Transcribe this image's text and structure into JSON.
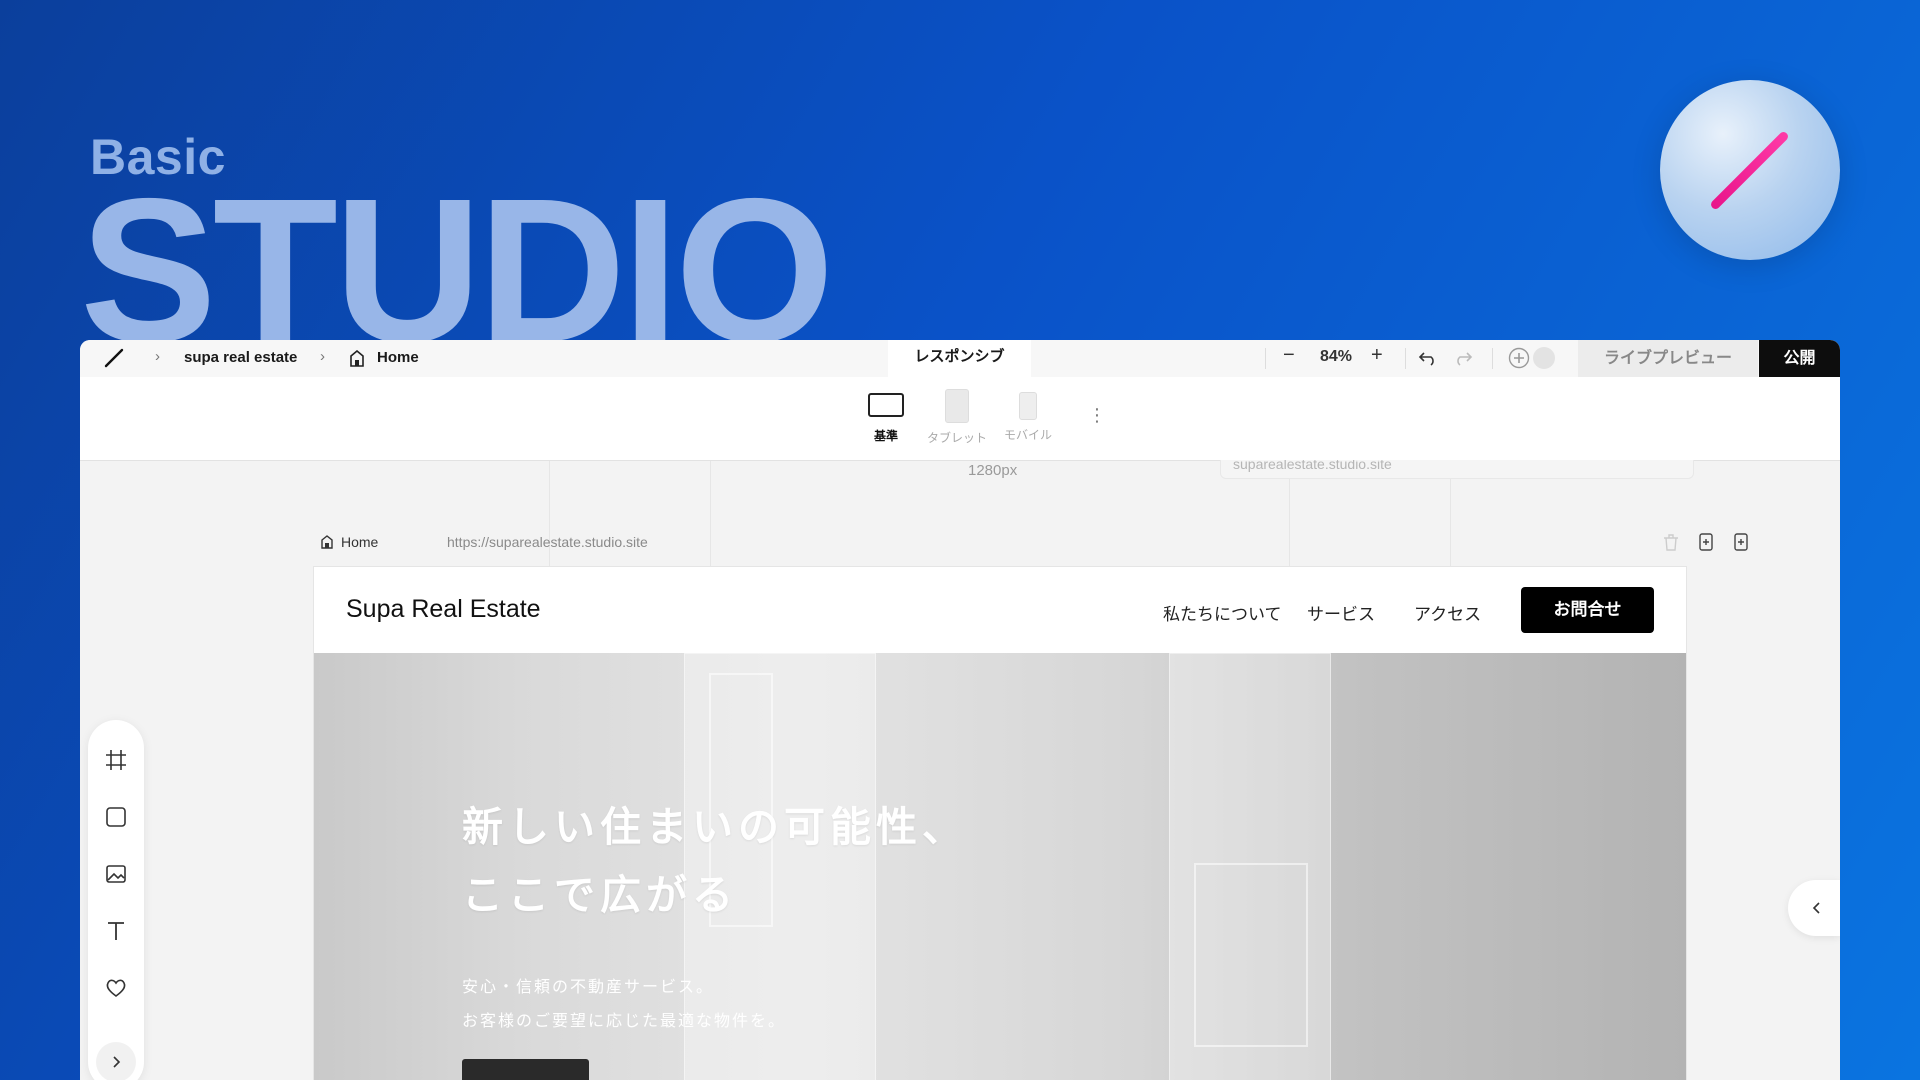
{
  "hero": {
    "basic": "Basic",
    "studio": "STUDIO"
  },
  "topbar": {
    "project": "supa real estate",
    "page": "Home",
    "mode_tab": "レスポンシブ",
    "zoom": "84%",
    "live_preview": "ライブプレビュー",
    "publish": "公開"
  },
  "devices": {
    "desktop": "基準",
    "tablet": "タブレット",
    "mobile": "モバイル"
  },
  "canvas": {
    "width_readout": "1280px",
    "url_ghost": "suparealestate.studio.site",
    "page_label": "Home",
    "page_url": "https://suparealestate.studio.site"
  },
  "site": {
    "brand": "Supa Real Estate",
    "nav": [
      "私たちについて",
      "サービス",
      "アクセス"
    ],
    "cta": "お問合せ",
    "heading_line1": "新しい住まいの可能性、",
    "heading_line2": "ここで広がる",
    "sub_line1": "安心・信頼の不動産サービス。",
    "sub_line2": "お客様のご要望に応じた最適な物件を。"
  },
  "colors": {
    "background_start": "#0b3f9c",
    "background_end": "#0a74e0",
    "accent_pink": "#e8148a",
    "publish_bg": "#0d0d0d",
    "cta_bg": "#000000"
  },
  "icons": {
    "logo": "slash-logo-icon",
    "breadcrumb_page": "home-icon",
    "tools": [
      "frame-icon",
      "box-icon",
      "image-icon",
      "text-icon",
      "heart-icon",
      "chevron-right-icon"
    ],
    "collapse": "chevron-left-icon"
  }
}
